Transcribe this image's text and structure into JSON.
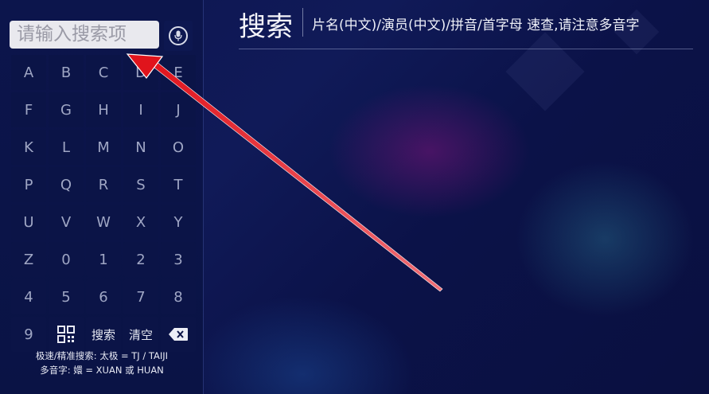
{
  "search": {
    "placeholder": "请输入搜索项"
  },
  "header": {
    "title": "搜索",
    "subtitle": "片名(中文)/演员(中文)/拼音/首字母 速查,请注意多音字"
  },
  "keyboard": {
    "keys": [
      "A",
      "B",
      "C",
      "D",
      "E",
      "F",
      "G",
      "H",
      "I",
      "J",
      "K",
      "L",
      "M",
      "N",
      "O",
      "P",
      "Q",
      "R",
      "S",
      "T",
      "U",
      "V",
      "W",
      "X",
      "Y",
      "Z",
      "0",
      "1",
      "2",
      "3",
      "4",
      "5",
      "6",
      "7",
      "8",
      "9"
    ],
    "search_label": "搜索",
    "clear_label": "清空"
  },
  "hints": {
    "line1": "极速/精准搜索: 太极 = TJ / TAIJI",
    "line2": "多音字: 嬛 = XUAN 或 HUAN"
  },
  "colors": {
    "background": "#0d1550",
    "panel": "#0c154c",
    "key": "#0b1447",
    "key_text": "#9fa6c4",
    "annotation_arrow": "#e0141c"
  }
}
